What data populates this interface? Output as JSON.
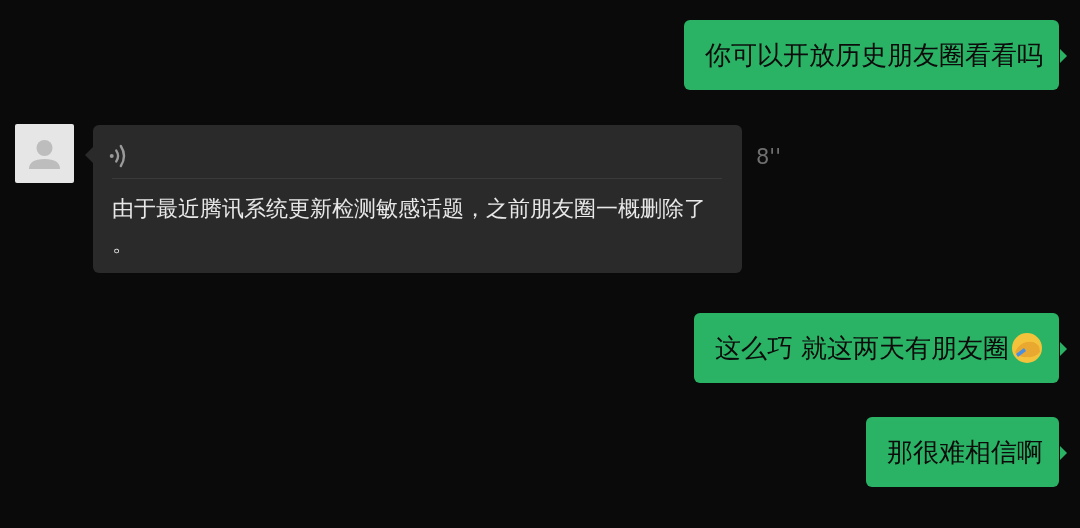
{
  "messages": [
    {
      "kind": "text",
      "outgoing": true,
      "text": "你可以开放历史朋友圈看看吗",
      "emoji": false
    },
    {
      "kind": "voice",
      "outgoing": false,
      "duration": "8''",
      "transcript": "由于最近腾讯系统更新检测敏感话题，之前朋友圈一概删除了。"
    },
    {
      "kind": "text",
      "outgoing": true,
      "text": "这么巧 就这两天有朋友圈",
      "emoji": true
    },
    {
      "kind": "text",
      "outgoing": true,
      "text": "那很难相信啊",
      "emoji": false
    }
  ]
}
